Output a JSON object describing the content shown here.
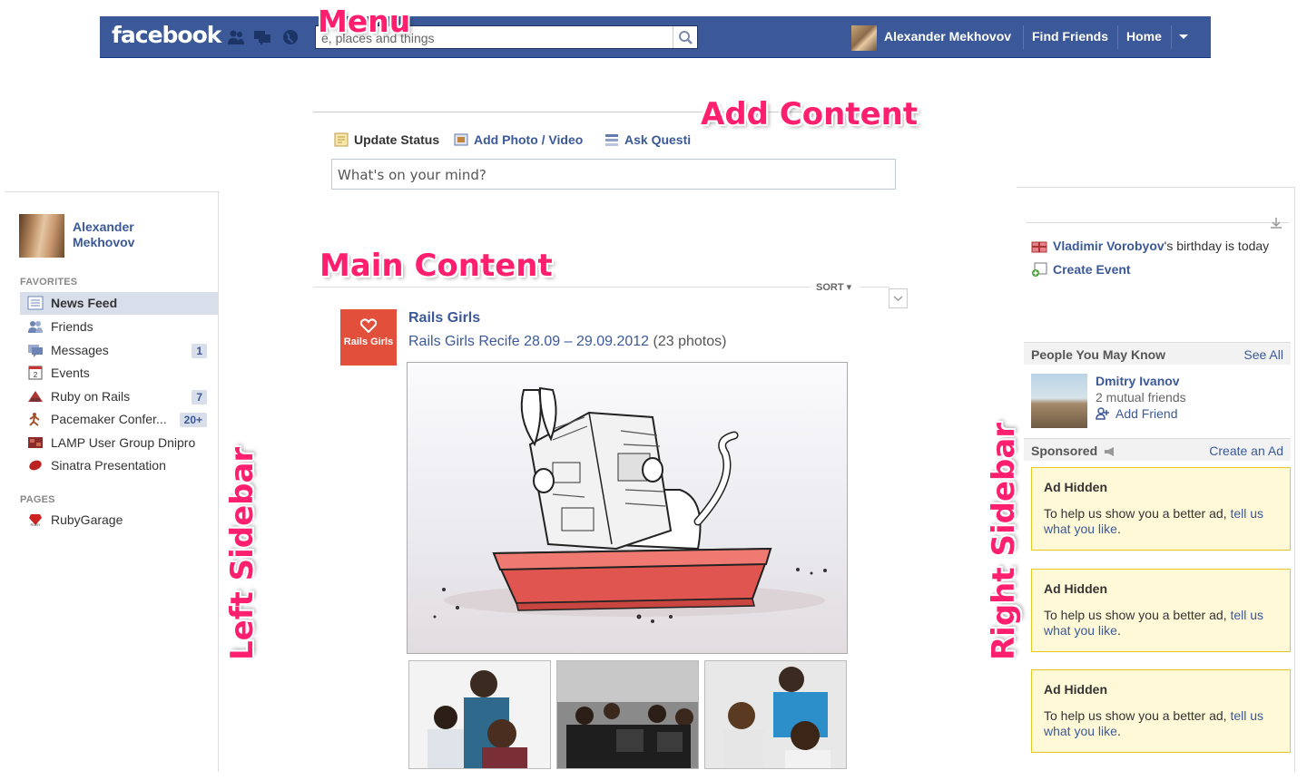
{
  "topbar": {
    "logo": "facebook",
    "search_placeholder": "e, places and things",
    "user_name": "Alexander Mekhovov",
    "find_friends": "Find Friends",
    "home": "Home"
  },
  "labels": {
    "menu": "Menu",
    "add_content": "Add Content",
    "main_content": "Main Content",
    "left_sidebar": "Left Sidebar",
    "right_sidebar": "Right Sidebar"
  },
  "composer": {
    "update_status": "Update Status",
    "add_photo": "Add Photo / Video",
    "ask_question": "Ask Questi",
    "placeholder": "What's on your mind?"
  },
  "left": {
    "user_first": "Alexander",
    "user_last": "Mekhovov",
    "favorites_heading": "FAVORITES",
    "pages_heading": "PAGES",
    "favorites": [
      {
        "label": "News Feed",
        "count": ""
      },
      {
        "label": "Friends",
        "count": ""
      },
      {
        "label": "Messages",
        "count": "1"
      },
      {
        "label": "Events",
        "count": ""
      },
      {
        "label": "Ruby on Rails",
        "count": "7"
      },
      {
        "label": "Pacemaker Confer...",
        "count": "20+"
      },
      {
        "label": "LAMP User Group Dnipro",
        "count": ""
      },
      {
        "label": "Sinatra Presentation",
        "count": ""
      }
    ],
    "pages": [
      {
        "label": "RubyGarage"
      }
    ]
  },
  "feed": {
    "sort": "SORT",
    "post": {
      "author": "Rails Girls",
      "logo_text": "Rails Girls",
      "album": "Rails Girls Recife 28.09 – 29.09.2012",
      "photo_count": "(23 photos)"
    }
  },
  "right": {
    "birthday_name": "Vladimir Vorobyov",
    "birthday_suffix": "'s birthday is today",
    "create_event": "Create Event",
    "pymk_title": "People You May Know",
    "see_all": "See All",
    "pymk_name": "Dmitry Ivanov",
    "pymk_mutual": "2 mutual friends",
    "pymk_add": "Add Friend",
    "sponsored": "Sponsored",
    "create_ad": "Create an Ad",
    "ads": [
      {
        "title": "Ad Hidden",
        "text": "To help us show you a better ad, ",
        "link": "tell us what you like",
        "end": "."
      },
      {
        "title": "Ad Hidden",
        "text": "To help us show you a better ad, ",
        "link": "tell us what you like",
        "end": "."
      },
      {
        "title": "Ad Hidden",
        "text": "To help us show you a better ad, ",
        "link": "tell us what you like",
        "end": "."
      }
    ]
  },
  "colors": {
    "brand": "#3b5998",
    "label_overlay": "#ff1f6f",
    "ad_background": "#fff9d7"
  }
}
